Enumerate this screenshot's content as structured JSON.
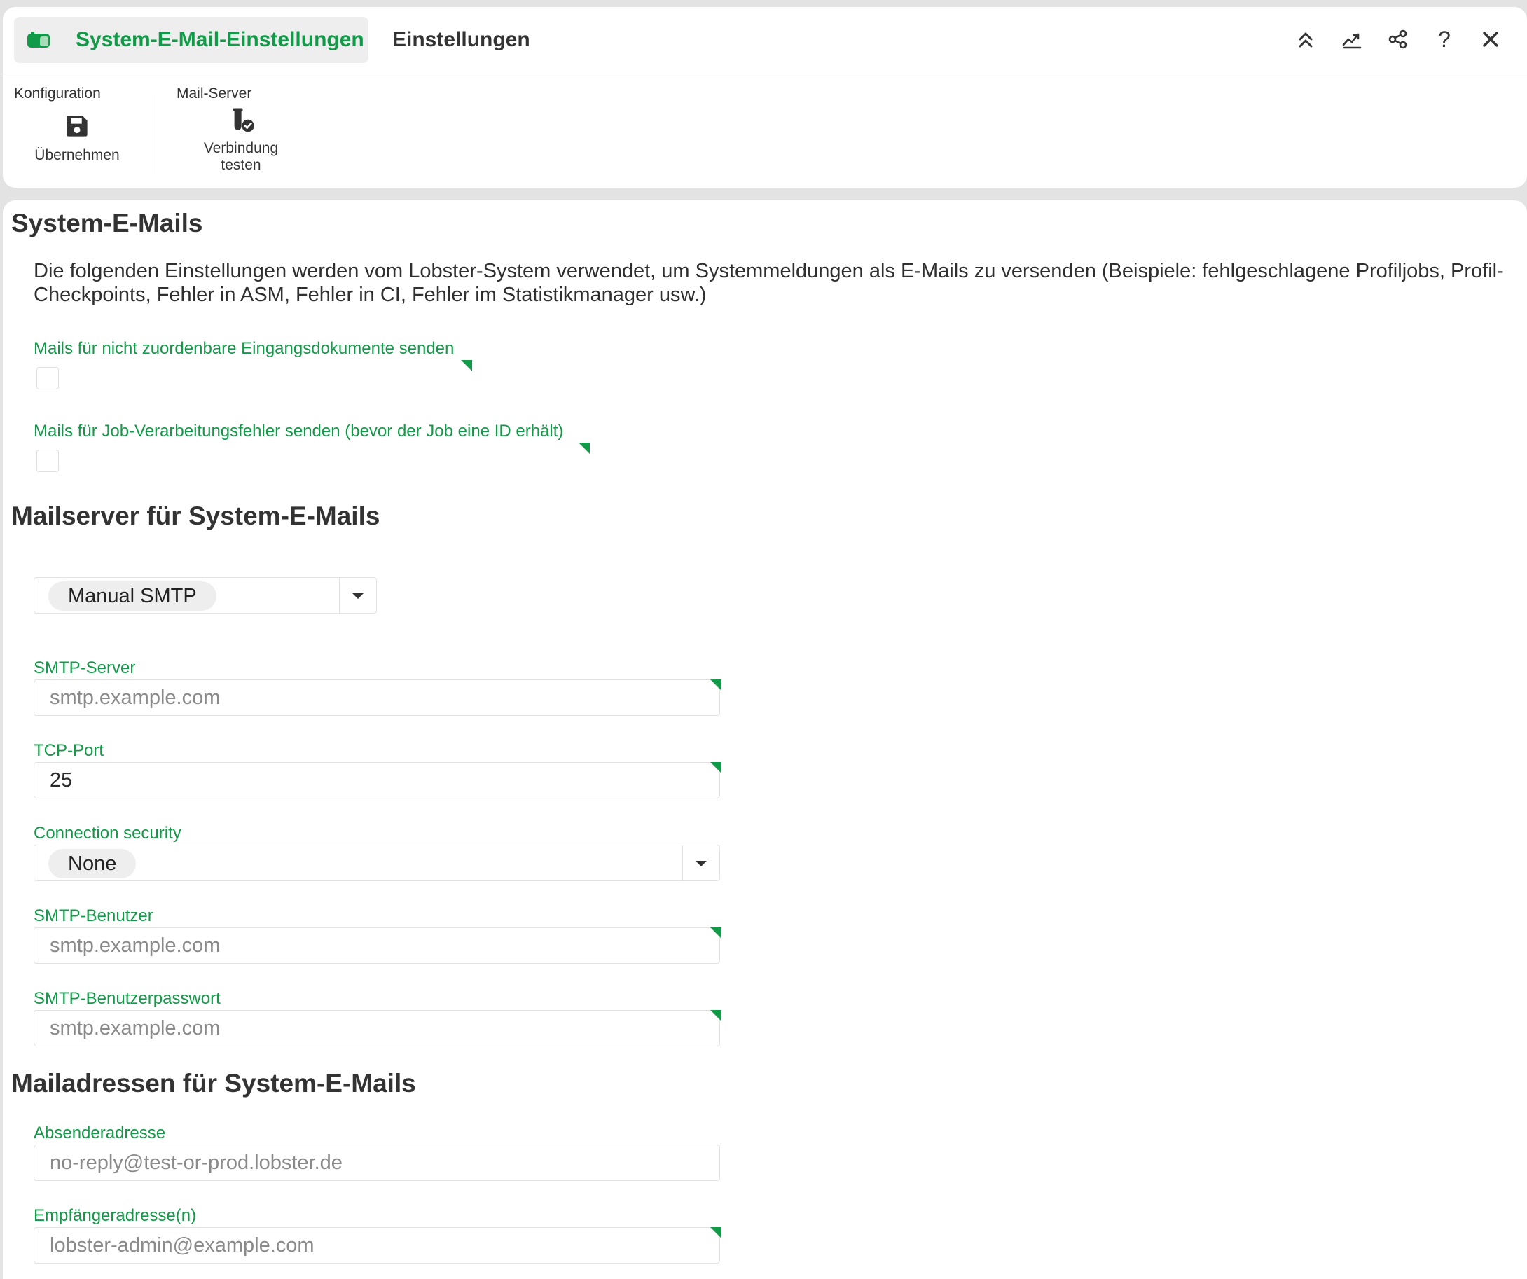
{
  "header": {
    "active_tab": "System-E-Mail-Einstellungen",
    "inactive_tab": "Einstellungen",
    "icons": [
      "collapse-up-icon",
      "chart-trend-icon",
      "share-icon",
      "help-icon",
      "close-icon"
    ],
    "help_glyph": "?"
  },
  "toolbar": {
    "groups": [
      {
        "label": "Konfiguration",
        "button_label": "Übernehmen",
        "icon": "save-icon"
      },
      {
        "label": "Mail-Server",
        "button_label_line1": "Verbindung",
        "button_label_line2": "testen",
        "icon": "test-tube-check-icon"
      }
    ]
  },
  "section_system_mails": {
    "title": "System-E-Mails",
    "description": "Die folgenden Einstellungen werden vom Lobster-System verwendet, um Systemmeldungen als E-Mails zu versenden (Beispiele: fehlgeschlagene Profiljobs, Profil-Checkpoints, Fehler in ASM, Fehler in CI, Fehler im Statistikmanager usw.)",
    "checkbox1_label": "Mails für nicht zuordenbare Eingangsdokumente senden",
    "checkbox1_checked": false,
    "checkbox2_label": "Mails für Job-Verarbeitungsfehler senden (bevor der Job eine ID erhält)",
    "checkbox2_checked": false
  },
  "section_mailserver": {
    "title": "Mailserver für System-E-Mails",
    "server_type": "Manual SMTP",
    "smtp_server_label": "SMTP-Server",
    "smtp_server_placeholder": "smtp.example.com",
    "tcp_port_label": "TCP-Port",
    "tcp_port_value": "25",
    "connection_security_label": "Connection security",
    "connection_security_value": "None",
    "smtp_user_label": "SMTP-Benutzer",
    "smtp_user_placeholder": "smtp.example.com",
    "smtp_password_label": "SMTP-Benutzerpasswort",
    "smtp_password_placeholder": "smtp.example.com"
  },
  "section_addresses": {
    "title": "Mailadressen für System-E-Mails",
    "sender_label": "Absenderadresse",
    "sender_placeholder": "no-reply@test-or-prod.lobster.de",
    "recipient_label": "Empfängeradresse(n)",
    "recipient_placeholder": "lobster-admin@example.com"
  },
  "colors": {
    "accent_green": "#119a47",
    "panel_bg": "#ffffff",
    "page_bg": "#e3e3e3"
  }
}
